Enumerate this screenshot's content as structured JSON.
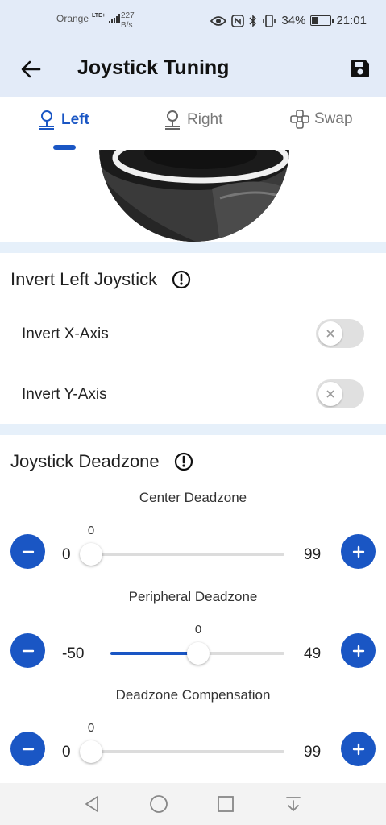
{
  "status_bar": {
    "carrier": "Orange",
    "network": "LTE+",
    "speed_value": "227",
    "speed_unit": "B/s",
    "battery": "34%",
    "battery_level": 0.34,
    "time": "21:01"
  },
  "app_bar": {
    "title": "Joystick Tuning",
    "back_icon": "arrow-left-icon",
    "save_icon": "floppy-disk-icon"
  },
  "tabs": [
    {
      "label": "Left",
      "icon": "joystick-icon",
      "active": true
    },
    {
      "label": "Right",
      "icon": "joystick-icon",
      "active": false
    },
    {
      "label": "Swap",
      "icon": "gamepad-swap-icon",
      "active": false
    }
  ],
  "invert_section": {
    "title": "Invert Left Joystick",
    "rows": [
      {
        "label": "Invert X-Axis",
        "enabled": false
      },
      {
        "label": "Invert Y-Axis",
        "enabled": false
      }
    ]
  },
  "deadzone_section": {
    "title": "Joystick Deadzone",
    "sliders": [
      {
        "title": "Center Deadzone",
        "min": "0",
        "max": "99",
        "value": "0",
        "min_num": 0,
        "max_num": 99,
        "value_num": 0
      },
      {
        "title": "Peripheral Deadzone",
        "min": "-50",
        "max": "49",
        "value": "0",
        "min_num": -50,
        "max_num": 49,
        "value_num": 0
      },
      {
        "title": "Deadzone Compensation",
        "min": "0",
        "max": "99",
        "value": "0",
        "min_num": 0,
        "max_num": 99,
        "value_num": 0
      }
    ]
  },
  "accent_color": "#1a56c4",
  "nav_bar": [
    "back-triangle-icon",
    "home-circle-icon",
    "recents-square-icon",
    "notification-pull-icon"
  ]
}
